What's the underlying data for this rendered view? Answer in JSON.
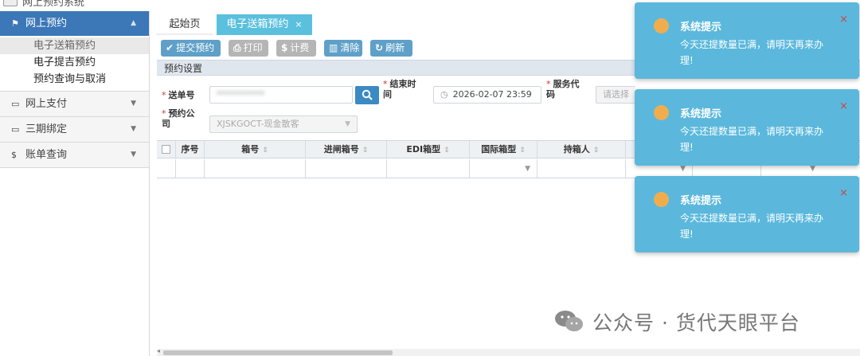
{
  "app": {
    "title": "网上预约系统"
  },
  "sidebar": {
    "groups": [
      {
        "label": "网上预约",
        "icon": "flag-icon",
        "expanded": true,
        "items": [
          {
            "label": "电子送箱预约",
            "selected": true
          },
          {
            "label": "电子提吉预约"
          },
          {
            "label": "预约查询与取消"
          }
        ]
      },
      {
        "label": "网上支付",
        "icon": "card-icon"
      },
      {
        "label": "三期绑定",
        "icon": "card-icon"
      },
      {
        "label": "账单查询",
        "icon": "dollar-icon"
      }
    ]
  },
  "tabs": [
    {
      "label": "起始页"
    },
    {
      "label": "电子送箱预约",
      "active": true,
      "close": "×"
    }
  ],
  "toolbar": {
    "submit": "提交预约",
    "print": "打印",
    "bill": "计费",
    "clear": "清除",
    "refresh": "刷新"
  },
  "panel": {
    "title": "预约设置"
  },
  "form": {
    "bill_no_label": "送单号",
    "bill_no_value": "***********",
    "end_time_label": "结束时间",
    "end_time_value": "2026-02-07 23:59",
    "service_code_label": "服务代码",
    "service_code_placeholder": "请选择",
    "company_label": "预约公司",
    "company_value": "XJSKGOCT-现金散客",
    "required_mark": "*"
  },
  "grid": {
    "columns": [
      "序号",
      "箱号",
      "进闸箱号",
      "EDI箱型",
      "国际箱型",
      "持箱人"
    ],
    "sort_glyph": "⇕"
  },
  "toasts": [
    {
      "title": "系统提示",
      "message": "今天还提数量已满，请明天再来办理!",
      "close": "×"
    },
    {
      "title": "系统提示",
      "message": "今天还提数量已满，请明天再来办理!",
      "close": "×"
    },
    {
      "title": "系统提示",
      "message": "今天还提数量已满，请明天再来办理!",
      "close": "×"
    }
  ],
  "watermark": {
    "text": "公众号 · 货代天眼平台"
  },
  "colors": {
    "primary": "#3c77b7",
    "toast": "#5bb8dc",
    "toast_dot": "#f0ad4e",
    "button": "#5fa0c8"
  }
}
